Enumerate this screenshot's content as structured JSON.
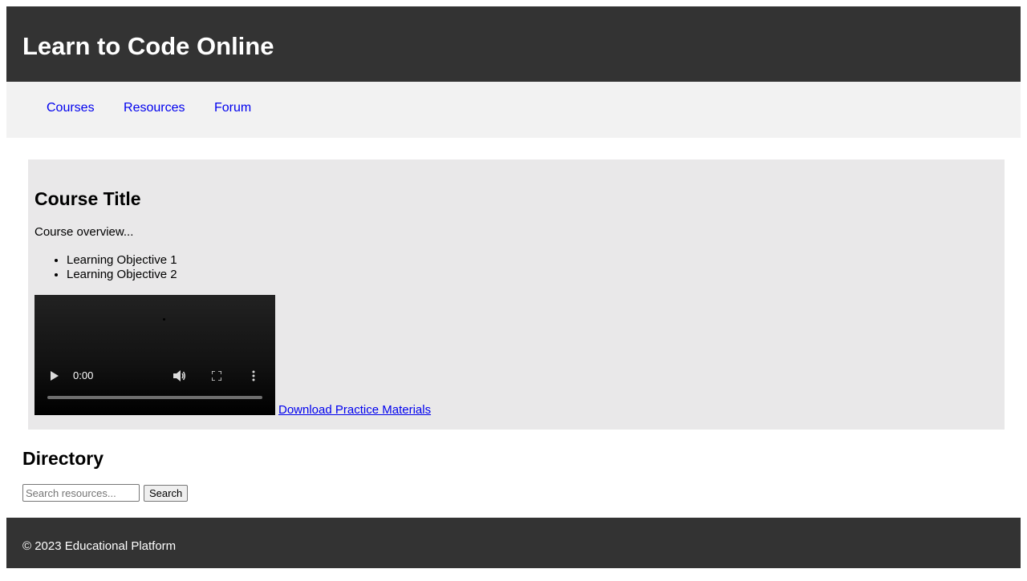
{
  "header": {
    "title": "Learn to Code Online"
  },
  "nav": {
    "items": [
      {
        "label": "Courses"
      },
      {
        "label": "Resources"
      },
      {
        "label": "Forum"
      }
    ]
  },
  "course": {
    "title": "Course Title",
    "overview": "Course overview...",
    "objectives": [
      "Learning Objective 1",
      "Learning Objective 2"
    ],
    "video": {
      "time": "0:00",
      "progress": 0,
      "icons": [
        "play-icon",
        "volume-icon",
        "fullscreen-icon",
        "more-icon"
      ]
    },
    "download_label": "Download Practice Materials"
  },
  "directory": {
    "title": "Directory",
    "search_placeholder": "Search resources...",
    "search_button": "Search"
  },
  "footer": {
    "text": "© 2023 Educational Platform"
  },
  "colors": {
    "header_bg": "#333333",
    "nav_bg": "#f2f2f2",
    "course_bg": "#e9e8e9",
    "link": "#0000ee"
  }
}
